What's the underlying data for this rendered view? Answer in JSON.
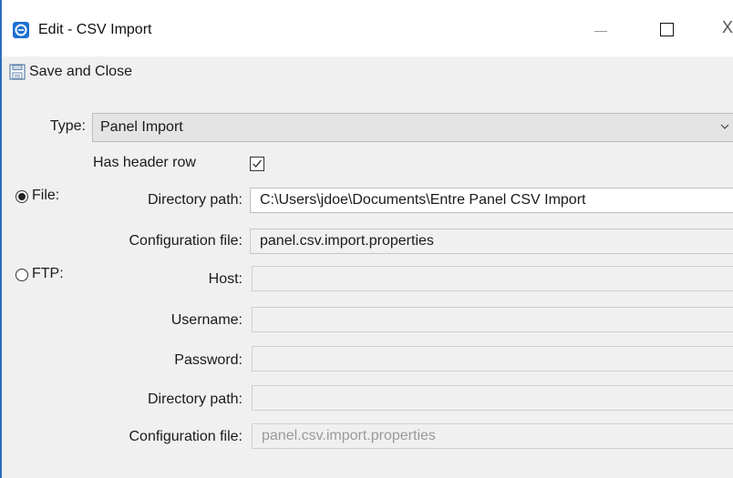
{
  "window": {
    "title": "Edit - CSV Import",
    "controls": {
      "minimize_icon": "minimize-icon",
      "maximize_icon": "maximize-icon",
      "close_label": "X"
    }
  },
  "toolbar": {
    "save_label": "Save and Close",
    "save_icon": "floppy-disk-icon"
  },
  "form": {
    "type": {
      "label": "Type:",
      "value": "Panel Import"
    },
    "header_row": {
      "label": "Has header row",
      "checked": true
    },
    "file": {
      "label": "File:",
      "selected": true,
      "directory_label": "Directory path:",
      "directory_value": "C:\\Users\\jdoe\\Documents\\Entre Panel CSV Import",
      "config_label": "Configuration file:",
      "config_value": "panel.csv.import.properties"
    },
    "ftp": {
      "label": "FTP:",
      "selected": false,
      "host_label": "Host:",
      "host_value": "",
      "username_label": "Username:",
      "username_value": "",
      "password_label": "Password:",
      "password_value": "",
      "directory_label": "Directory path:",
      "directory_value": "",
      "config_label": "Configuration file:",
      "config_value": "panel.csv.import.properties"
    }
  },
  "colors": {
    "accent": "#1e6fd0",
    "window_border": "#2b6fbf"
  }
}
